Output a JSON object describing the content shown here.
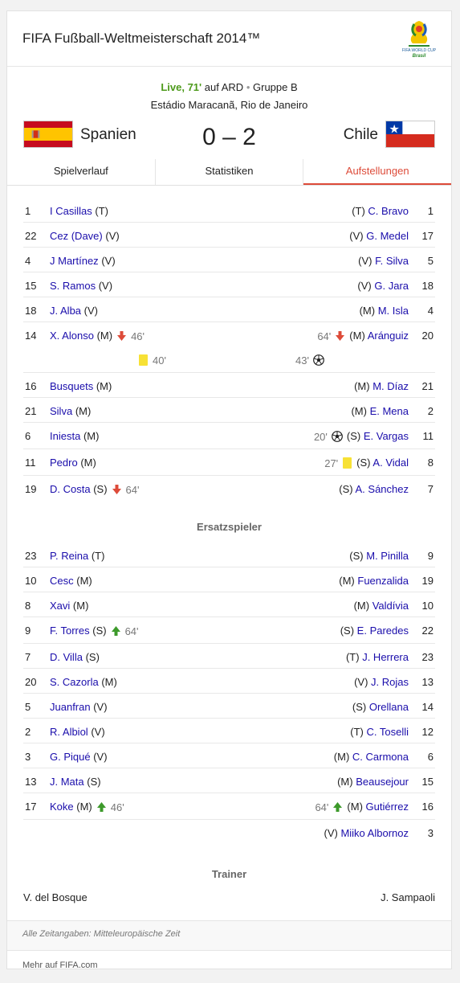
{
  "header": {
    "title": "FIFA Fußball-Weltmeisterschaft 2014™",
    "logo_text": "FIFA WORLD CUP",
    "logo_sub": "Brasil"
  },
  "match": {
    "live": "Live, 71'",
    "broadcaster": "auf ARD",
    "separator": "•",
    "group": "Gruppe B",
    "venue": "Estádio Maracanã, Rio de Janeiro",
    "home": "Spanien",
    "away": "Chile",
    "score": "0 – 2"
  },
  "tabs": [
    "Spielverlauf",
    "Statistiken",
    "Aufstellungen"
  ],
  "starters": [
    {
      "l": {
        "num": "1",
        "name": "I Casillas",
        "pos": "(T)"
      },
      "r": {
        "num": "1",
        "name": "C. Bravo",
        "pos": "(T)"
      }
    },
    {
      "l": {
        "num": "22",
        "name": "Cez (Dave)",
        "pos": "(V)"
      },
      "r": {
        "num": "17",
        "name": "G. Medel",
        "pos": "(V)"
      }
    },
    {
      "l": {
        "num": "4",
        "name": "J Martínez",
        "pos": "(V)"
      },
      "r": {
        "num": "5",
        "name": "F. Silva",
        "pos": "(V)"
      }
    },
    {
      "l": {
        "num": "15",
        "name": "S. Ramos",
        "pos": "(V)"
      },
      "r": {
        "num": "18",
        "name": "G. Jara",
        "pos": "(V)"
      }
    },
    {
      "l": {
        "num": "18",
        "name": "J. Alba",
        "pos": "(V)"
      },
      "r": {
        "num": "4",
        "name": "M. Isla",
        "pos": "(M)"
      }
    },
    {
      "l": {
        "num": "14",
        "name": "X. Alonso",
        "pos": "(M)",
        "sub_out": "46'",
        "card": "40'"
      },
      "r": {
        "num": "20",
        "name": "Aránguiz",
        "pos": "(M)",
        "sub_out": "64'",
        "goal": "43'"
      }
    },
    {
      "l": {
        "num": "16",
        "name": "Busquets",
        "pos": "(M)"
      },
      "r": {
        "num": "21",
        "name": "M. Díaz",
        "pos": "(M)"
      }
    },
    {
      "l": {
        "num": "21",
        "name": "Silva",
        "pos": "(M)"
      },
      "r": {
        "num": "2",
        "name": "E. Mena",
        "pos": "(M)"
      }
    },
    {
      "l": {
        "num": "6",
        "name": "Iniesta",
        "pos": "(M)"
      },
      "r": {
        "num": "11",
        "name": "E. Vargas",
        "pos": "(S)",
        "goal_inline": "20'"
      }
    },
    {
      "l": {
        "num": "11",
        "name": "Pedro",
        "pos": "(M)"
      },
      "r": {
        "num": "8",
        "name": "A. Vidal",
        "pos": "(S)",
        "card_inline": "27'"
      }
    },
    {
      "l": {
        "num": "19",
        "name": "D. Costa",
        "pos": "(S)",
        "sub_out": "64'"
      },
      "r": {
        "num": "7",
        "name": "A. Sánchez",
        "pos": "(S)"
      }
    }
  ],
  "subs_title": "Ersatzspieler",
  "subs": [
    {
      "l": {
        "num": "23",
        "name": "P. Reina",
        "pos": "(T)"
      },
      "r": {
        "num": "9",
        "name": "M. Pinilla",
        "pos": "(S)"
      }
    },
    {
      "l": {
        "num": "10",
        "name": "Cesc",
        "pos": "(M)"
      },
      "r": {
        "num": "19",
        "name": "Fuenzalida",
        "pos": "(M)"
      }
    },
    {
      "l": {
        "num": "8",
        "name": "Xavi",
        "pos": "(M)"
      },
      "r": {
        "num": "10",
        "name": "Valdívia",
        "pos": "(M)"
      }
    },
    {
      "l": {
        "num": "9",
        "name": "F. Torres",
        "pos": "(S)",
        "sub_in": "64'"
      },
      "r": {
        "num": "22",
        "name": "E. Paredes",
        "pos": "(S)"
      }
    },
    {
      "l": {
        "num": "7",
        "name": "D. Villa",
        "pos": "(S)"
      },
      "r": {
        "num": "23",
        "name": "J. Herrera",
        "pos": "(T)"
      }
    },
    {
      "l": {
        "num": "20",
        "name": "S. Cazorla",
        "pos": "(M)"
      },
      "r": {
        "num": "13",
        "name": "J. Rojas",
        "pos": "(V)"
      }
    },
    {
      "l": {
        "num": "5",
        "name": "Juanfran",
        "pos": "(V)"
      },
      "r": {
        "num": "14",
        "name": "Orellana",
        "pos": "(S)"
      }
    },
    {
      "l": {
        "num": "2",
        "name": "R. Albiol",
        "pos": "(V)"
      },
      "r": {
        "num": "12",
        "name": "C. Toselli",
        "pos": "(T)"
      }
    },
    {
      "l": {
        "num": "3",
        "name": "G. Piqué",
        "pos": "(V)"
      },
      "r": {
        "num": "6",
        "name": "C. Carmona",
        "pos": "(M)"
      }
    },
    {
      "l": {
        "num": "13",
        "name": "J. Mata",
        "pos": "(S)"
      },
      "r": {
        "num": "15",
        "name": "Beausejour",
        "pos": "(M)"
      }
    },
    {
      "l": {
        "num": "17",
        "name": "Koke",
        "pos": "(M)",
        "sub_in": "46'"
      },
      "r": {
        "num": "16",
        "name": "Gutiérrez",
        "pos": "(M)",
        "sub_in": "64'"
      }
    },
    {
      "l": null,
      "r": {
        "num": "3",
        "name": "Miiko Albornoz",
        "pos": "(V)"
      }
    }
  ],
  "trainer_title": "Trainer",
  "trainers": {
    "home": "V. del Bosque",
    "away": "J. Sampaoli"
  },
  "footer": {
    "note": "Alle Zeitangaben: Mitteleuropäische Zeit",
    "link": "Mehr auf FIFA.com"
  },
  "colors": {
    "link": "#1a0dab",
    "live": "#4d9a1b",
    "active_tab": "#dd4b39",
    "card": "#f7e135",
    "arrow_down": "#dd4b39",
    "arrow_up": "#3d9a2b"
  },
  "icons": {
    "sub_out": "arrow-down-icon",
    "sub_in": "arrow-up-icon",
    "card": "yellow-card-icon",
    "goal": "football-icon"
  }
}
